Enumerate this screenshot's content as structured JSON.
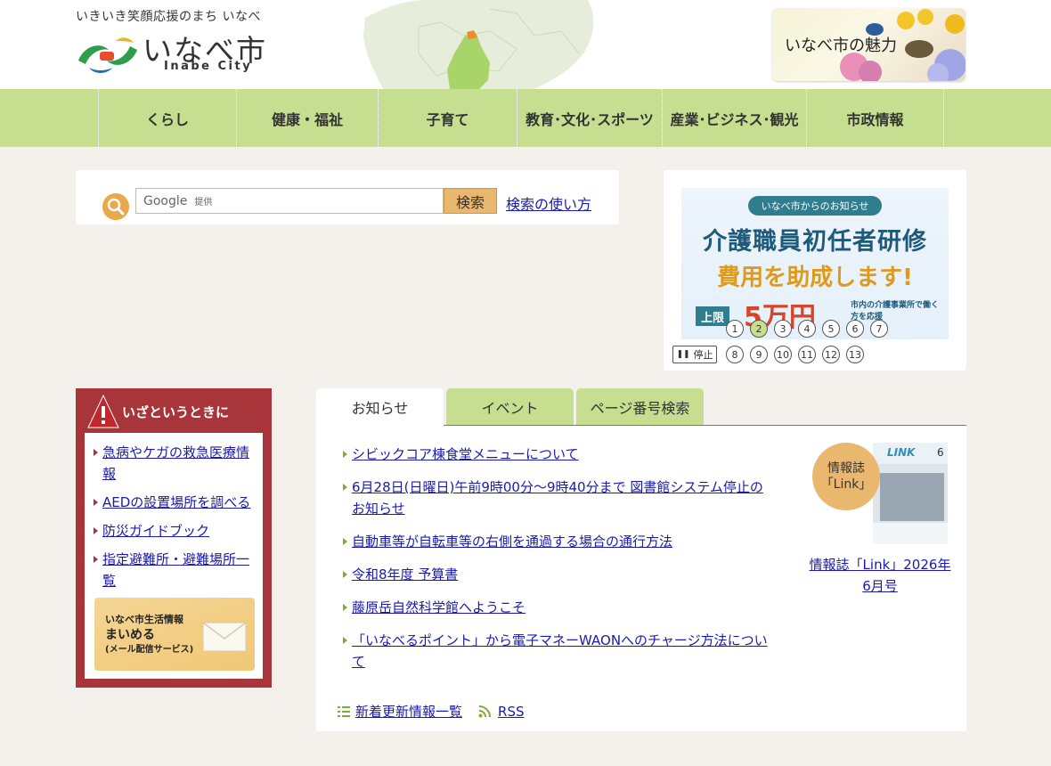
{
  "header": {
    "tagline": "いきいき笑顔応援のまち いなべ",
    "logo_name": "いなべ市",
    "logo_sub": "Inabe City",
    "banner_text": "いなべ市の魅力"
  },
  "nav": {
    "items": [
      {
        "label": "くらし"
      },
      {
        "label": "健康・福祉"
      },
      {
        "label": "子育て"
      },
      {
        "label": "教育･文化･スポーツ"
      },
      {
        "label": "産業･ビジネス･観光"
      },
      {
        "label": "市政情報"
      }
    ]
  },
  "search": {
    "placeholder_brand": "Google",
    "placeholder_suffix": "提供",
    "button_label": "検索",
    "help_link": "検索の使い方"
  },
  "slider": {
    "header": "いなべ市からのお知らせ",
    "title": "介護職員初任者研修",
    "subtitle": "費用を助成します!",
    "limit_label": "上限",
    "limit_value": "5万円",
    "note": "市内の介護事業所で働く方を応援",
    "pause_label": "停止",
    "dots_row1": [
      "1",
      "2",
      "3",
      "4",
      "5",
      "6",
      "7"
    ],
    "dots_row2": [
      "8",
      "9",
      "10",
      "11",
      "12",
      "13"
    ],
    "active_dot": "2"
  },
  "emergency": {
    "title": "いざというときに",
    "links": [
      "急病やケガの救急医療情報",
      "AEDの設置場所を調べる",
      "防災ガイドブック",
      "指定避難所・避難場所一覧"
    ],
    "mail_line1": "いなべ市生活情報",
    "mail_line2": "まいめる",
    "mail_line3": "(メール配信サービス)"
  },
  "tabs": [
    {
      "label": "お知らせ",
      "active": true
    },
    {
      "label": "イベント",
      "active": false
    },
    {
      "label": "ページ番号検索",
      "active": false
    }
  ],
  "news": {
    "items": [
      "シビックコア棟食堂メニューについて",
      "6月28日(日曜日)午前9時00分～9時40分まで 図書館システム停止のお知らせ",
      "自動車等が自転車等の右側を通過する場合の通行方法",
      "令和8年度 予算書",
      "藤原岳自然科学館へようこそ",
      "「いなべるポイント」から電子マネーWAONへのチャージ方法について"
    ],
    "badge_line1": "情報誌",
    "badge_line2": "「Link」",
    "cover_issue": "6",
    "cover_brand": "LINK",
    "link_caption": "情報誌「Link」2026年6月号",
    "list_link": "新着更新情報一覧",
    "rss_link": "RSS"
  },
  "colors": {
    "nav_green": "#c6de8f",
    "emergency_red": "#a7353a",
    "accent_orange": "#e9b86e",
    "link_blue": "#1a1ab0"
  }
}
